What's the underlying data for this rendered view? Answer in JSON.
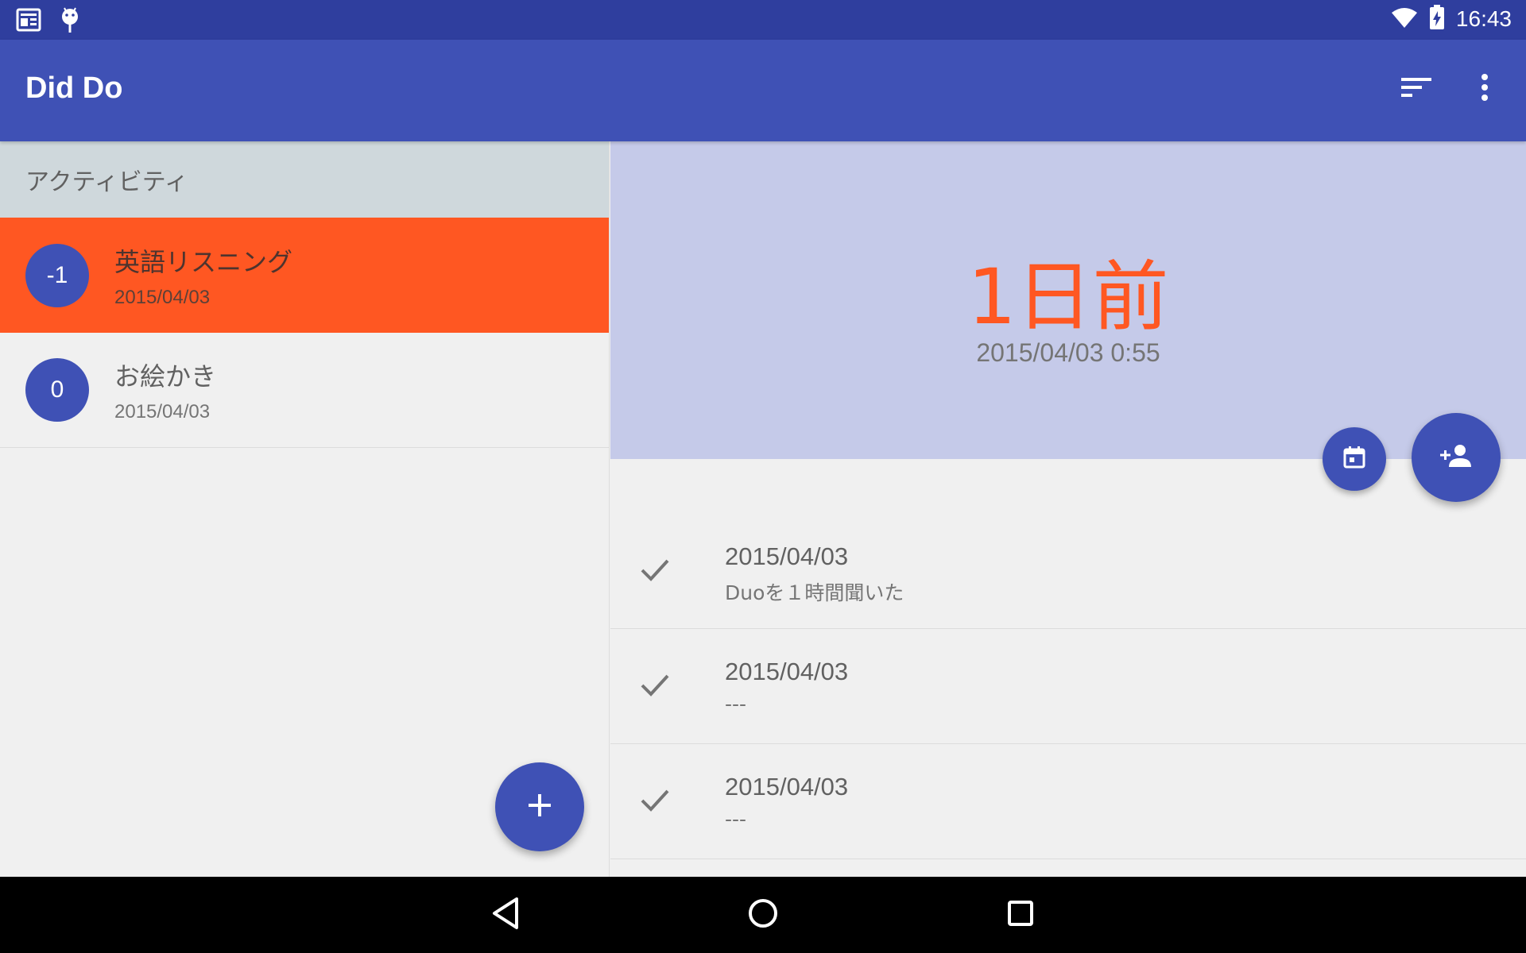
{
  "status_bar": {
    "time": "16:43",
    "left_icons": [
      "news-icon",
      "android-icon"
    ],
    "right_icons": [
      "wifi-icon",
      "battery-charging-icon"
    ]
  },
  "app_bar": {
    "title": "Did Do",
    "actions": [
      "sort-icon",
      "more-vert-icon"
    ]
  },
  "sidebar": {
    "section_label": "アクティビティ",
    "items": [
      {
        "count": "-1",
        "title": "英語リスニング",
        "date": "2015/04/03",
        "selected": true
      },
      {
        "count": "0",
        "title": "お絵かき",
        "date": "2015/04/03",
        "selected": false
      }
    ],
    "fab_icon": "add-icon"
  },
  "detail": {
    "elapsed": "1日前",
    "last_time": "2015/04/03 0:55",
    "fab_small_icon": "calendar-icon",
    "fab_large_icon": "person-add-icon",
    "history": [
      {
        "date": "2015/04/03",
        "note": "Duoを１時間聞いた"
      },
      {
        "date": "2015/04/03",
        "note": "---"
      },
      {
        "date": "2015/04/03",
        "note": "---"
      }
    ]
  },
  "colors": {
    "primary": "#3f51b5",
    "primary_dark": "#2f3e9e",
    "accent": "#ff5722",
    "header_tint": "#c5cae9",
    "section_bg": "#cfd8dc"
  },
  "nav_bar": [
    "back-icon",
    "home-icon",
    "recents-icon"
  ]
}
